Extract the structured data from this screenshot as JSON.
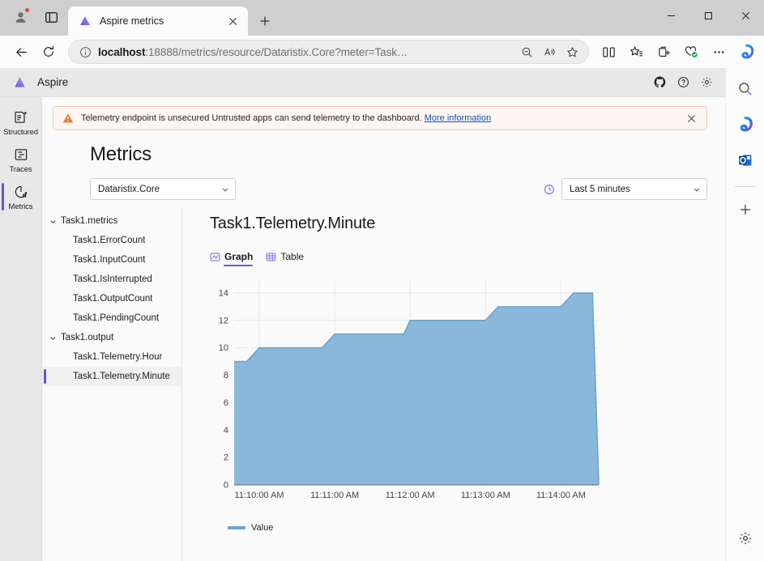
{
  "browser": {
    "tab": {
      "title": "Aspire metrics",
      "favicon": "aspire-logo-icon",
      "close_label": "×"
    },
    "new_tab_label": "+",
    "address": {
      "url_host": "localhost",
      "url_rest": ":18888/metrics/resource/Dataristix.Core?meter=Task…"
    },
    "window_controls": {
      "minimize": "—",
      "maximize": "□",
      "close": "✕"
    },
    "toolbar_icons": [
      "split-screen-icon",
      "favorites-icon",
      "collections-icon",
      "browser-essentials-icon",
      "settings-more-icon",
      "copilot-icon"
    ],
    "nav_icons": [
      "back-arrow-icon",
      "refresh-icon"
    ],
    "omnibox_icons": [
      "info-icon",
      "zoom-out-icon",
      "read-aloud-icon",
      "add-favorite-icon"
    ],
    "edge_sidebar_icons": [
      "search-icon",
      "copilot-icon",
      "outlook-icon",
      "add-sidebar-icon",
      "sidebar-settings-icon"
    ]
  },
  "app": {
    "name": "Aspire",
    "header_icons": [
      "github-icon",
      "help-icon",
      "settings-gear-icon"
    ],
    "rail": [
      {
        "label": "Structured",
        "icon": "structured-logs-icon",
        "active": false
      },
      {
        "label": "Traces",
        "icon": "traces-icon",
        "active": false
      },
      {
        "label": "Metrics",
        "icon": "metrics-icon",
        "active": true
      }
    ],
    "banner": {
      "text": "Telemetry endpoint is unsecured Untrusted apps can send telemetry to the dashboard.",
      "link": "More information",
      "icon": "warning-triangle-icon",
      "close": "✕"
    },
    "page_title": "Metrics",
    "resource_select": {
      "value": "Dataristix.Core"
    },
    "time_select": {
      "value": "Last 5 minutes",
      "icon": "clock-icon"
    },
    "tree": [
      {
        "label": "Task1.metrics",
        "type": "group",
        "expanded": true,
        "selected": false
      },
      {
        "label": "Task1.ErrorCount",
        "type": "leaf",
        "selected": false
      },
      {
        "label": "Task1.InputCount",
        "type": "leaf",
        "selected": false
      },
      {
        "label": "Task1.IsInterrupted",
        "type": "leaf",
        "selected": false
      },
      {
        "label": "Task1.OutputCount",
        "type": "leaf",
        "selected": false
      },
      {
        "label": "Task1.PendingCount",
        "type": "leaf",
        "selected": false
      },
      {
        "label": "Task1.output",
        "type": "group",
        "expanded": true,
        "selected": false
      },
      {
        "label": "Task1.Telemetry.Hour",
        "type": "leaf",
        "selected": false
      },
      {
        "label": "Task1.Telemetry.Minute",
        "type": "leaf",
        "selected": true
      }
    ],
    "chart_header": "Task1.Telemetry.Minute",
    "view_tabs": [
      {
        "label": "Graph",
        "icon": "line-chart-icon",
        "active": true
      },
      {
        "label": "Table",
        "icon": "table-grid-icon",
        "active": false
      }
    ]
  },
  "chart_data": {
    "type": "area",
    "title": "Task1.Telemetry.Minute",
    "xlabel": "",
    "ylabel": "",
    "grid": true,
    "legend_position": "bottom-left",
    "series": [
      {
        "name": "Value",
        "color": "#6aa4ce",
        "fill": "#84b4d8",
        "x": [
          "11:09:40 AM",
          "11:09:50 AM",
          "11:10:00 AM",
          "11:10:30 AM",
          "11:10:50 AM",
          "11:11:00 AM",
          "11:11:40 AM",
          "11:11:55 AM",
          "11:12:00 AM",
          "11:12:45 AM",
          "11:13:00 AM",
          "11:13:10 AM",
          "11:13:45 AM",
          "11:14:00 AM",
          "11:14:10 AM",
          "11:14:25 AM",
          "11:14:30 AM"
        ],
        "values": [
          9,
          9,
          10,
          10,
          10,
          11,
          11,
          11,
          12,
          12,
          12,
          13,
          13,
          13,
          14,
          14,
          0
        ]
      }
    ],
    "ytick_labels": [
      "0",
      "2",
      "4",
      "6",
      "8",
      "10",
      "12",
      "14"
    ],
    "ytick_values": [
      0,
      2,
      4,
      6,
      8,
      10,
      12,
      14
    ],
    "ylim": [
      0,
      15
    ],
    "xtick_labels": [
      "11:10:00 AM",
      "11:11:00 AM",
      "11:12:00 AM",
      "11:13:00 AM",
      "11:14:00 AM"
    ],
    "legend": [
      "Value"
    ]
  }
}
